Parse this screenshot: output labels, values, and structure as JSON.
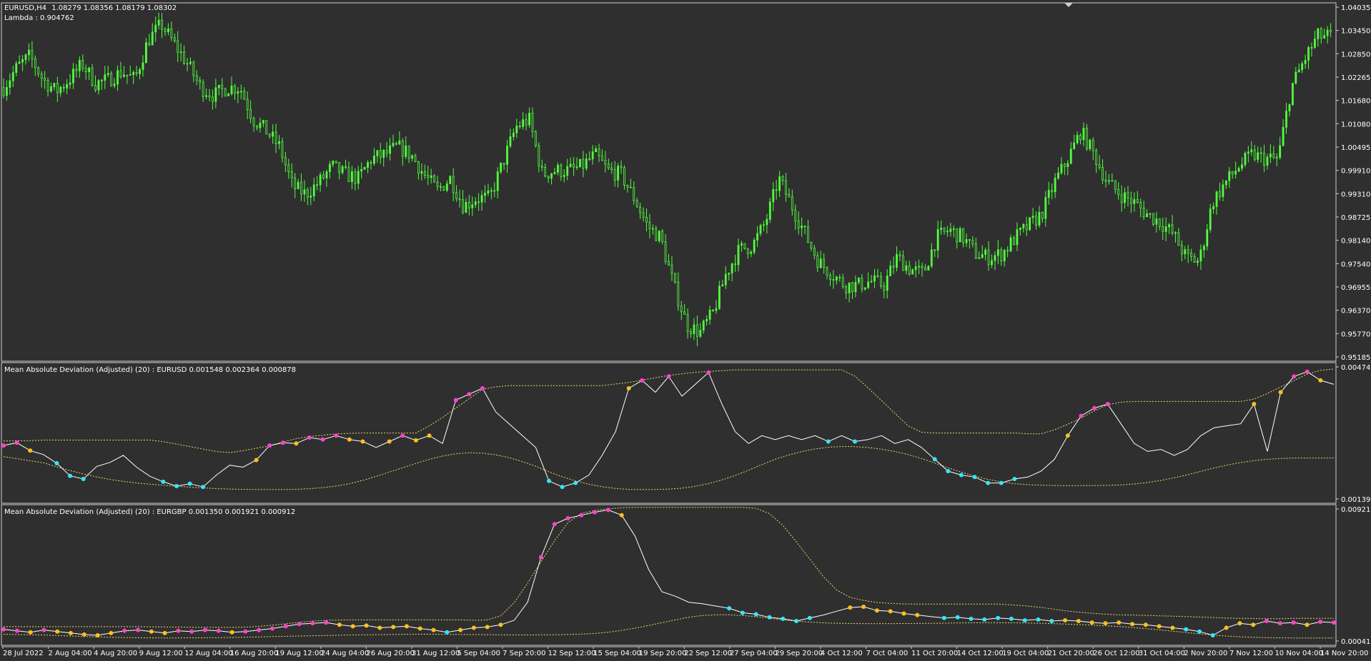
{
  "window": {
    "symbol_label": "EURUSD,H4",
    "ohlc": "1.08279 1.08356 1.08179 1.08302",
    "lambda_label": "Lambda : 0.904762"
  },
  "colors": {
    "background": "#2f2f2f",
    "candles": "#52ff3f",
    "mad_line": "#ffffff",
    "bands": "#e8d86a",
    "high_dots": "#ff44cc",
    "mid_dots": "#ffc21a",
    "low_dots": "#33e6ff",
    "frame": "#cfcfcf"
  },
  "chart_data": [
    {
      "type": "candlestick",
      "title": "EURUSD,H4",
      "ylim": [
        0.95185,
        1.04035
      ],
      "y_ticks": [
        "1.04035",
        "1.03450",
        "1.02850",
        "1.02265",
        "1.01680",
        "1.01080",
        "1.00495",
        "0.99910",
        "0.99310",
        "0.98725",
        "0.98140",
        "0.97540",
        "0.96955",
        "0.96370",
        "0.95770",
        "0.95185"
      ],
      "series": [
        {
          "name": "EURUSD",
          "values": [
            1.02,
            1.025,
            1.028,
            1.022,
            1.019,
            1.022,
            1.026,
            1.021,
            1.022,
            1.024,
            1.022,
            1.032,
            1.036,
            1.031,
            1.026,
            1.02,
            1.018,
            1.02,
            1.02,
            1.012,
            1.009,
            1.005,
            0.995,
            0.993,
            0.996,
            1.0,
            0.998,
            0.997,
            1.002,
            1.003,
            1.005,
            1.003,
            0.998,
            0.994,
            0.997,
            0.99,
            0.992,
            0.992,
            1.001,
            1.01,
            1.012,
            0.998,
            0.999,
            0.999,
            1.0,
            1.003,
            0.999,
            0.998,
            0.992,
            0.985,
            0.982,
            0.97,
            0.96,
            0.958,
            0.963,
            0.973,
            0.979,
            0.98,
            0.986,
            0.997,
            0.99,
            0.983,
            0.976,
            0.973,
            0.97,
            0.97,
            0.971,
            0.97,
            0.977,
            0.974,
            0.973,
            0.982,
            0.984,
            0.982,
            0.978,
            0.977,
            0.978,
            0.982,
            0.985,
            0.988,
            0.996,
            1.002,
            1.009,
            1.003,
            0.996,
            0.993,
            0.991,
            0.988,
            0.986,
            0.983,
            0.977,
            0.976,
            0.991,
            0.996,
            1.0,
            1.003,
            1.002,
            1.002,
            1.02,
            1.027,
            1.033,
            1.033
          ]
        }
      ]
    },
    {
      "type": "line",
      "title": "Mean Absolute Deviation (Adjusted) (20) : EURUSD 0.001548 0.002364 0.000878",
      "ylim": [
        0.001394,
        0.004742
      ],
      "y_ticks": [
        "0.004742",
        "0.001394"
      ],
      "series": [
        {
          "name": "EURUSD",
          "values": [
            0.00275,
            0.00282,
            0.00262,
            0.00252,
            0.0023,
            0.00198,
            0.0019,
            0.00222,
            0.00232,
            0.0025,
            0.0022,
            0.00197,
            0.00183,
            0.00172,
            0.00178,
            0.0017,
            0.002,
            0.00225,
            0.0022,
            0.00238,
            0.00275,
            0.00282,
            0.0028,
            0.00295,
            0.0029,
            0.003,
            0.0029,
            0.00285,
            0.0027,
            0.00285,
            0.003,
            0.00288,
            0.003,
            0.0028,
            0.0039,
            0.00405,
            0.0042,
            0.0036,
            0.0033,
            0.003,
            0.0027,
            0.00185,
            0.0017,
            0.0018,
            0.002,
            0.0025,
            0.0031,
            0.0042,
            0.0044,
            0.0041,
            0.0045,
            0.004,
            0.0043,
            0.0046,
            0.0038,
            0.0031,
            0.0028,
            0.003,
            0.0029,
            0.003,
            0.0029,
            0.003,
            0.00285,
            0.003,
            0.00285,
            0.0029,
            0.003,
            0.0028,
            0.0029,
            0.0027,
            0.0024,
            0.0021,
            0.002,
            0.00195,
            0.0018,
            0.0018,
            0.0019,
            0.00195,
            0.0021,
            0.0024,
            0.003,
            0.0035,
            0.0037,
            0.0038,
            0.0033,
            0.0028,
            0.0026,
            0.00265,
            0.0025,
            0.00265,
            0.003,
            0.0032,
            0.00325,
            0.0033,
            0.0038,
            0.0026,
            0.0041,
            0.0045,
            0.00462,
            0.0044,
            0.0043
          ]
        }
      ]
    },
    {
      "type": "line",
      "title": "Mean Absolute Deviation (Adjusted) (20) : EURGBP 0.001350 0.001921 0.000912",
      "ylim": [
        0.000419,
        0.009216
      ],
      "y_ticks": [
        "0.009216",
        "0.000419"
      ],
      "series": [
        {
          "name": "EURGBP",
          "values": [
            0.0012,
            0.0011,
            0.001,
            0.00115,
            0.00105,
            0.00095,
            0.00085,
            0.0008,
            0.00095,
            0.0011,
            0.00115,
            0.00105,
            0.00095,
            0.0011,
            0.00105,
            0.00115,
            0.0011,
            0.001,
            0.00105,
            0.00115,
            0.00125,
            0.0014,
            0.00155,
            0.0016,
            0.00165,
            0.0015,
            0.0014,
            0.00145,
            0.0013,
            0.00135,
            0.0014,
            0.00125,
            0.00115,
            0.001,
            0.00115,
            0.0013,
            0.00135,
            0.0015,
            0.0018,
            0.003,
            0.006,
            0.0082,
            0.0086,
            0.0088,
            0.009,
            0.00915,
            0.0088,
            0.0074,
            0.0052,
            0.0037,
            0.0034,
            0.003,
            0.0029,
            0.00275,
            0.0026,
            0.0023,
            0.0022,
            0.002,
            0.0019,
            0.00175,
            0.00195,
            0.00215,
            0.0024,
            0.00265,
            0.0027,
            0.00245,
            0.0024,
            0.00225,
            0.00215,
            0.00205,
            0.00195,
            0.002,
            0.0019,
            0.00185,
            0.00195,
            0.0019,
            0.0018,
            0.00185,
            0.00175,
            0.0018,
            0.00175,
            0.00165,
            0.0016,
            0.00165,
            0.00155,
            0.0015,
            0.0014,
            0.0013,
            0.0012,
            0.00105,
            0.0008,
            0.0013,
            0.0016,
            0.0015,
            0.00175,
            0.0016,
            0.00165,
            0.0015,
            0.0017,
            0.00165
          ]
        }
      ]
    }
  ],
  "x_axis": {
    "labels": [
      "28 Jul 2022",
      "2 Aug 04:00",
      "4 Aug 20:00",
      "9 Aug 12:00",
      "12 Aug 04:00",
      "16 Aug 20:00",
      "19 Aug 12:00",
      "24 Aug 04:00",
      "26 Aug 20:00",
      "31 Aug 12:00",
      "5 Sep 04:00",
      "7 Sep 20:00",
      "12 Sep 12:00",
      "15 Sep 04:00",
      "19 Sep 20:00",
      "22 Sep 12:00",
      "27 Sep 04:00",
      "29 Sep 20:00",
      "4 Oct 12:00",
      "7 Oct 04:00",
      "11 Oct 20:00",
      "14 Oct 12:00",
      "19 Oct 04:00",
      "21 Oct 20:00",
      "26 Oct 12:00",
      "31 Oct 04:00",
      "2 Nov 20:00",
      "7 Nov 12:00",
      "10 Nov 04:00",
      "14 Nov 20:00"
    ]
  }
}
